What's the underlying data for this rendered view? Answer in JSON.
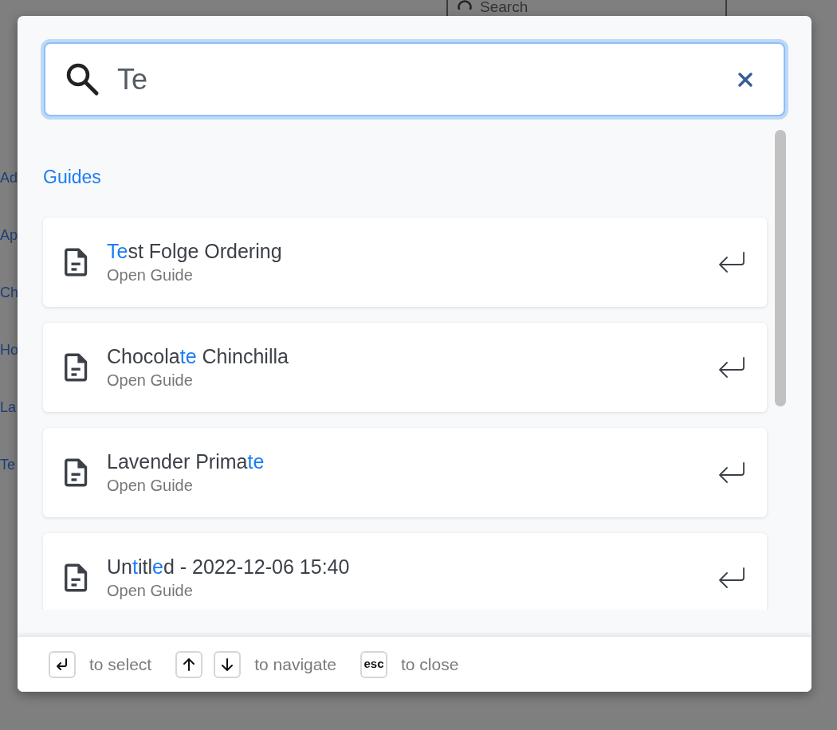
{
  "background": {
    "search": {
      "placeholder": "Search"
    },
    "sidebar_links": [
      "Ad",
      "Ap",
      "Ch",
      "Ho",
      "La",
      "Te"
    ]
  },
  "search": {
    "value": "Te"
  },
  "section": "Guides",
  "results": [
    {
      "title": [
        {
          "text": "Te",
          "match": true
        },
        {
          "text": "st Folge Ordering",
          "match": false
        }
      ],
      "subtitle": "Open Guide"
    },
    {
      "title": [
        {
          "text": "Chocola",
          "match": false
        },
        {
          "text": "te",
          "match": true
        },
        {
          "text": " Chinchilla",
          "match": false
        }
      ],
      "subtitle": "Open Guide"
    },
    {
      "title": [
        {
          "text": "Lavender Prima",
          "match": false
        },
        {
          "text": "te",
          "match": true
        }
      ],
      "subtitle": "Open Guide"
    },
    {
      "title": [
        {
          "text": "Un",
          "match": false
        },
        {
          "text": "t",
          "match": true
        },
        {
          "text": "itl",
          "match": false
        },
        {
          "text": "e",
          "match": true
        },
        {
          "text": "d - 2022-12-06 15:40",
          "match": false
        }
      ],
      "subtitle": "Open Guide"
    }
  ],
  "footer": [
    {
      "keys": [
        {
          "kind": "return"
        }
      ],
      "label": "to select"
    },
    {
      "keys": [
        {
          "kind": "up"
        },
        {
          "kind": "down"
        }
      ],
      "label": "to navigate"
    },
    {
      "keys": [
        {
          "kind": "text",
          "text": "esc"
        }
      ],
      "label": "to close"
    }
  ]
}
